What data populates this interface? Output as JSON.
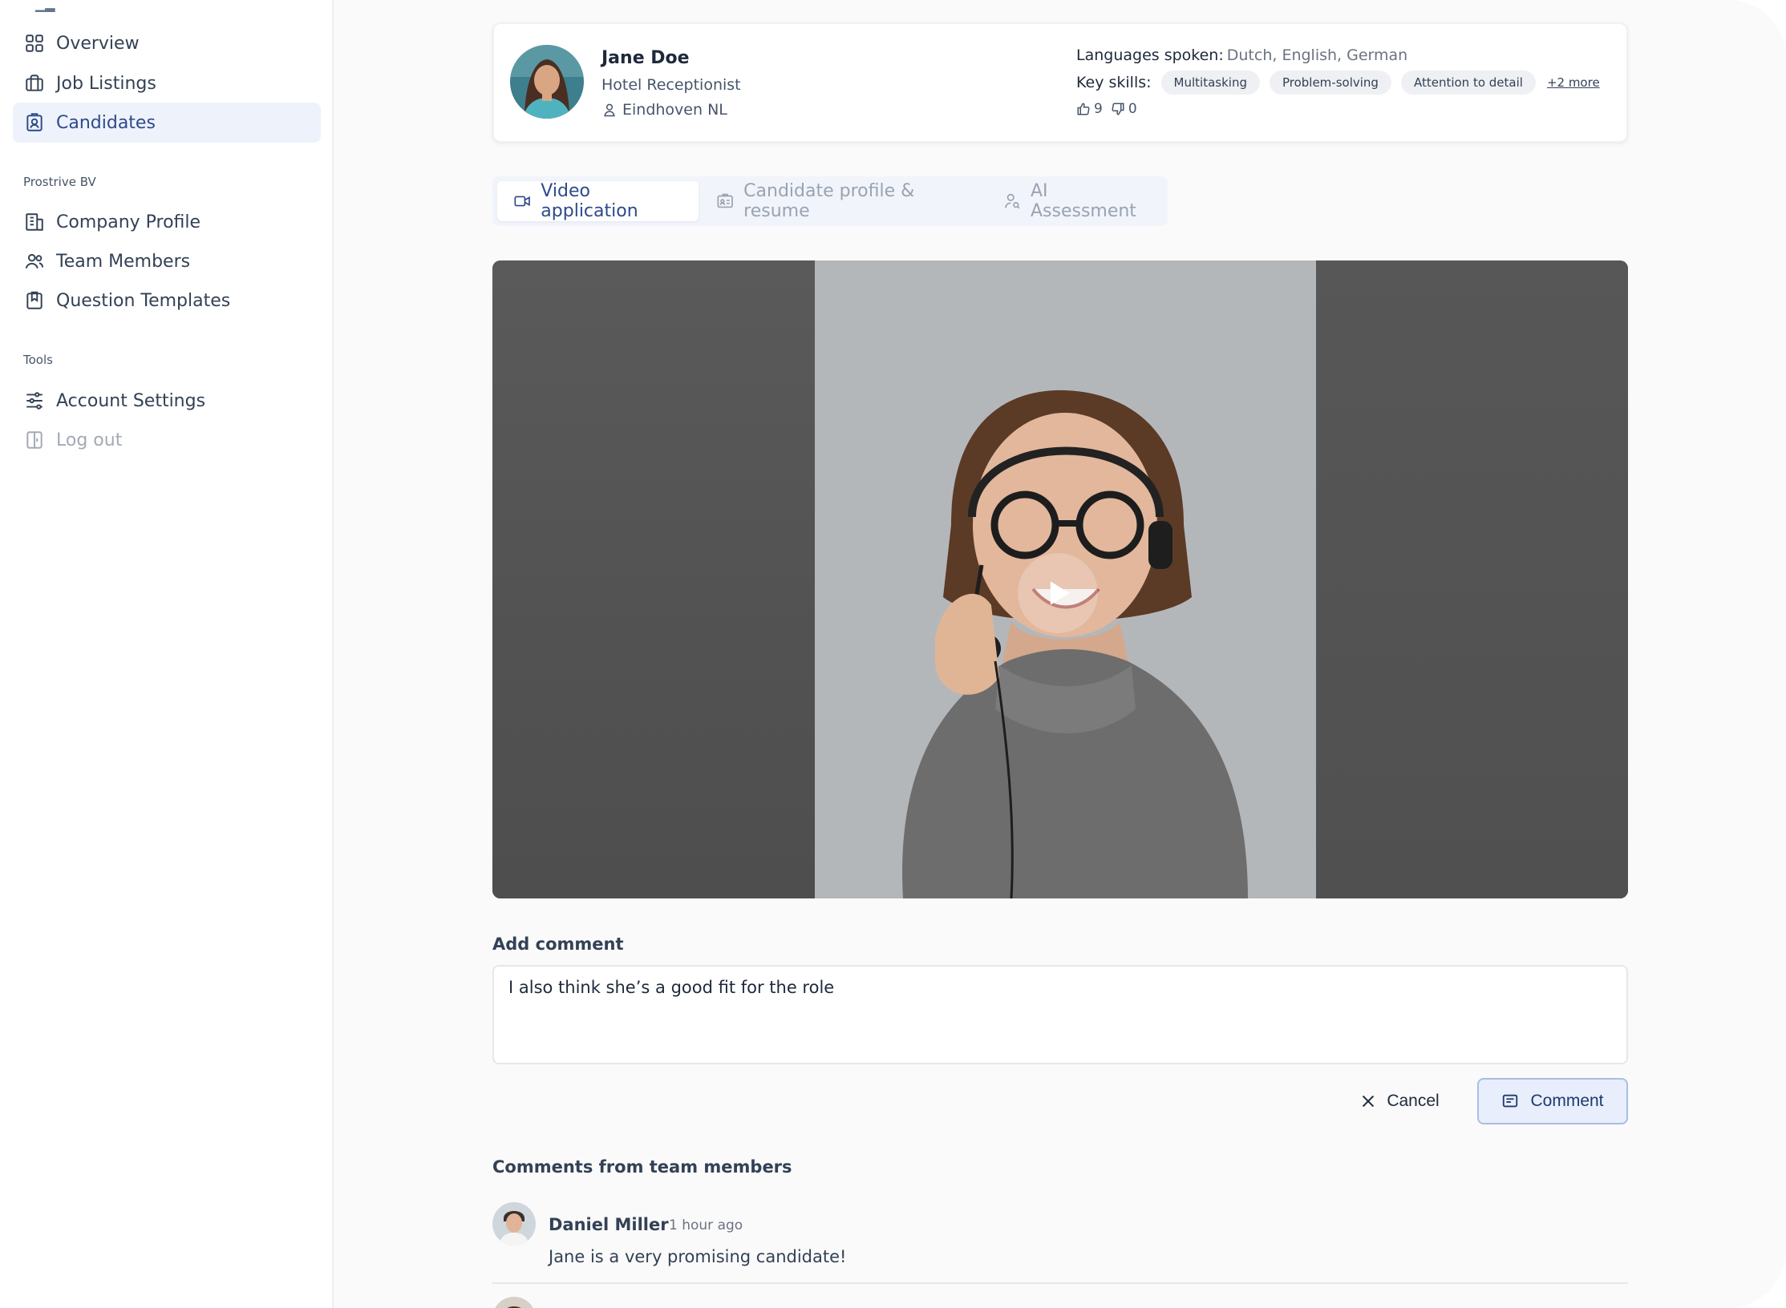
{
  "sidebar": {
    "nav": [
      {
        "label": "Overview",
        "icon": "grid-icon"
      },
      {
        "label": "Job Listings",
        "icon": "briefcase-icon"
      },
      {
        "label": "Candidates",
        "icon": "badge-icon",
        "active": true
      }
    ],
    "company_group_label": "Prostrive BV",
    "company_nav": [
      {
        "label": "Company Profile",
        "icon": "building-icon"
      },
      {
        "label": "Team Members",
        "icon": "users-icon"
      },
      {
        "label": "Question Templates",
        "icon": "clipboard-icon"
      }
    ],
    "tools_group_label": "Tools",
    "tools_nav": [
      {
        "label": "Account Settings",
        "icon": "sliders-icon"
      },
      {
        "label": "Log out",
        "icon": "logout-icon"
      }
    ]
  },
  "candidate": {
    "name": "Jane Doe",
    "role": "Hotel Receptionist",
    "location": "Eindhoven NL",
    "languages_label": "Languages spoken:",
    "languages": "Dutch, English, German",
    "skills_label": "Key skills:",
    "skills": [
      "Multitasking",
      "Problem-solving",
      "Attention to detail"
    ],
    "more_skills": "+2 more",
    "upvotes": "9",
    "downvotes": "0"
  },
  "tabs": [
    {
      "label": "Video application",
      "icon": "video-icon",
      "active": true
    },
    {
      "label": "Candidate profile & resume",
      "icon": "id-card-icon"
    },
    {
      "label": "AI Assessment",
      "icon": "user-search-icon"
    }
  ],
  "comment_form": {
    "label": "Add comment",
    "value": "I also think she’s a good fit for the role",
    "cancel_label": "Cancel",
    "submit_label": "Comment"
  },
  "comments": {
    "title": "Comments from team members",
    "items": [
      {
        "author": "Daniel Miller",
        "time": "1 hour ago",
        "text": "Jane is a very promising candidate!"
      }
    ]
  },
  "colors": {
    "accent": "#2d4a8a",
    "active_bg": "#eef2fb",
    "button_border": "#a9bde6"
  }
}
